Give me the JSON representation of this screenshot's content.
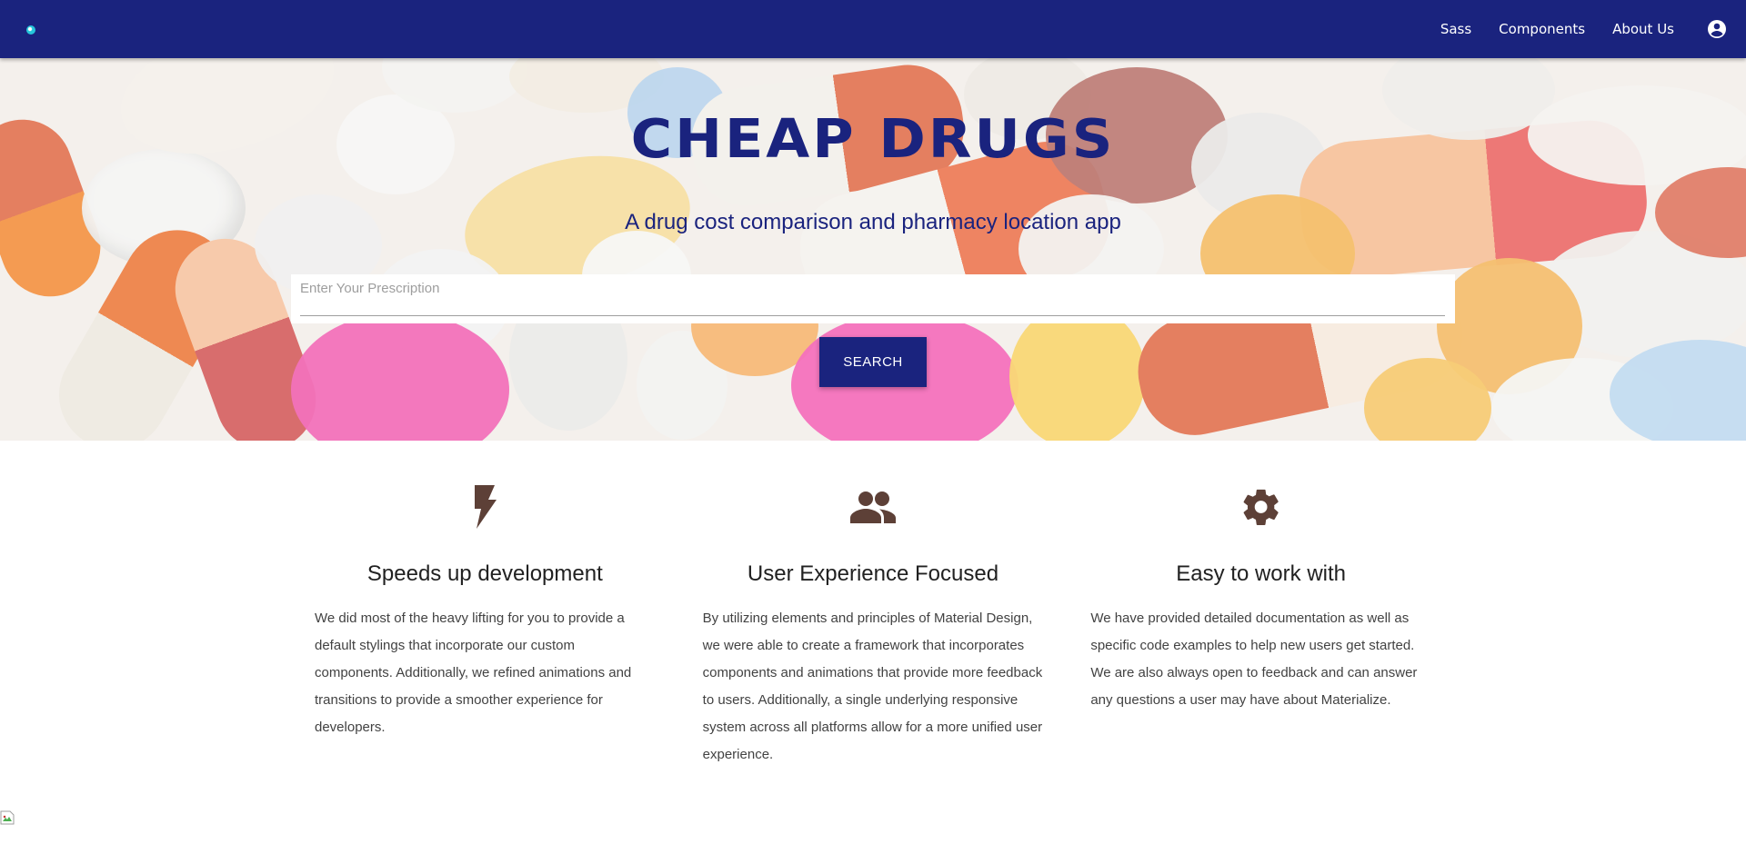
{
  "nav": {
    "logo_icon": "logo-icon",
    "links": [
      "Sass",
      "Components",
      "About Us"
    ],
    "account_icon": "account-circle-icon"
  },
  "hero": {
    "title": "CHEAP DRUGS",
    "subtitle": "A drug cost comparison and pharmacy location app",
    "search_placeholder": "Enter Your Prescription",
    "search_value": "",
    "search_button": "SEARCH",
    "background": "pills-photo"
  },
  "features": [
    {
      "icon": "flash-icon",
      "title": "Speeds up development",
      "text": "We did most of the heavy lifting for you to provide a default stylings that incorporate our custom components. Additionally, we refined animations and transitions to provide a smoother experience for developers."
    },
    {
      "icon": "group-icon",
      "title": "User Experience Focused",
      "text": "By utilizing elements and principles of Material Design, we were able to create a framework that incorporates components and animations that provide more feedback to users. Additionally, a single underlying responsive system across all platforms allow for a more unified user experience."
    },
    {
      "icon": "settings-icon",
      "title": "Easy to work with",
      "text": "We have provided detailed documentation as well as specific code examples to help new users get started. We are also always open to feedback and can answer any questions a user may have about Materialize."
    }
  ],
  "colors": {
    "primary": "#1a237e",
    "icon": "#5d4037",
    "accent_logo": "#26c6da"
  }
}
